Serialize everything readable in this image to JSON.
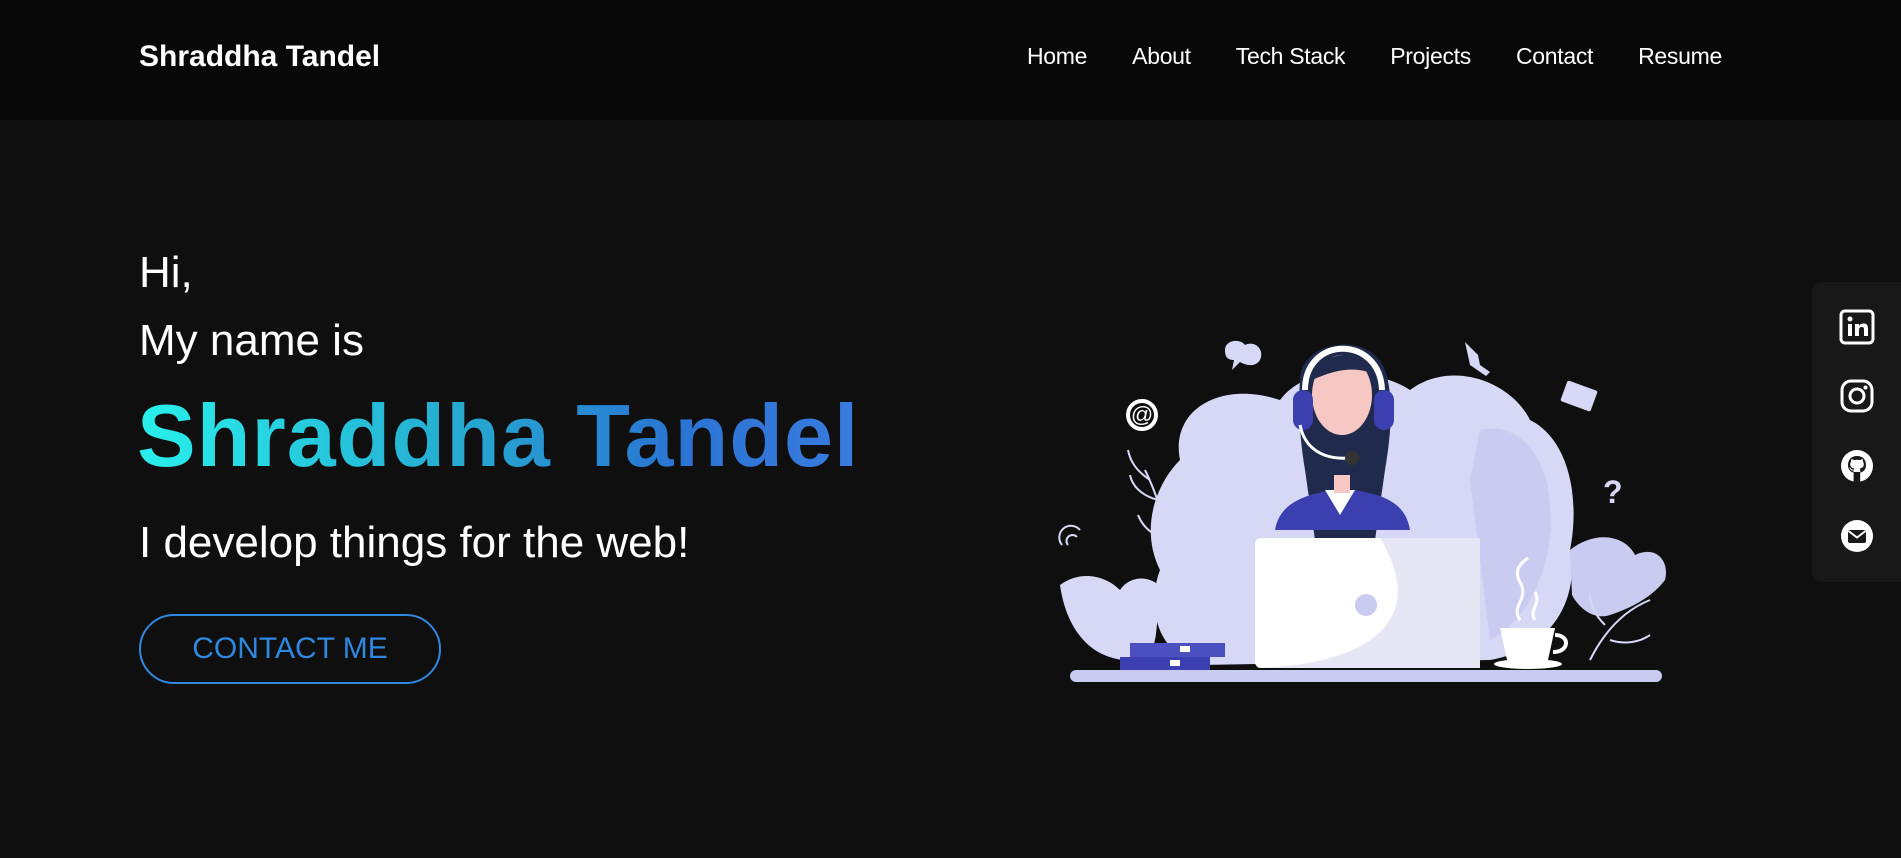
{
  "header": {
    "brand": "Shraddha Tandel",
    "nav": [
      {
        "label": "Home"
      },
      {
        "label": "About"
      },
      {
        "label": "Tech Stack"
      },
      {
        "label": "Projects"
      },
      {
        "label": "Contact"
      },
      {
        "label": "Resume"
      }
    ]
  },
  "hero": {
    "greeting": "Hi,",
    "intro": "My name is",
    "name": "Shraddha Tandel",
    "tagline": "I develop things for the web!",
    "cta_label": "CONTACT ME"
  },
  "social": {
    "icons": [
      "linkedin-icon",
      "instagram-icon",
      "github-icon",
      "email-icon"
    ]
  },
  "colors": {
    "background": "#0f0f0f",
    "navbar": "#080808",
    "accent": "#2f87e0",
    "gradient_start": "#29f0ec",
    "gradient_end": "#3a7be0",
    "illustration_lavender": "#d7d8f6",
    "illustration_indigo": "#3b3fb0"
  }
}
